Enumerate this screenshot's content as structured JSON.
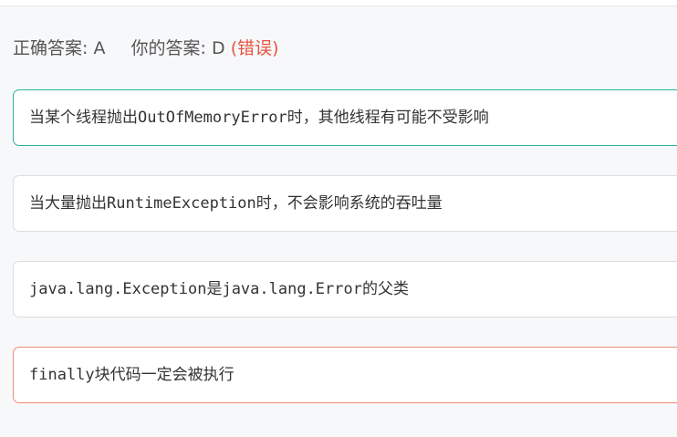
{
  "result": {
    "correct_label": "正确答案:",
    "correct_value": "A",
    "your_label": "你的答案:",
    "your_value": "D",
    "status": "(错误)"
  },
  "options": [
    {
      "text": "当某个线程抛出OutOfMemoryError时，其他线程有可能不受影响",
      "state": "correct"
    },
    {
      "text": "当大量抛出RuntimeException时，不会影响系统的吞吐量",
      "state": "normal"
    },
    {
      "text": "java.lang.Exception是java.lang.Error的父类",
      "state": "normal"
    },
    {
      "text": "finally块代码一定会被执行",
      "state": "wrong"
    }
  ],
  "colors": {
    "correct_border": "#25b4a0",
    "wrong_border": "#ef8a7b",
    "wrong_text": "#e5553f"
  }
}
